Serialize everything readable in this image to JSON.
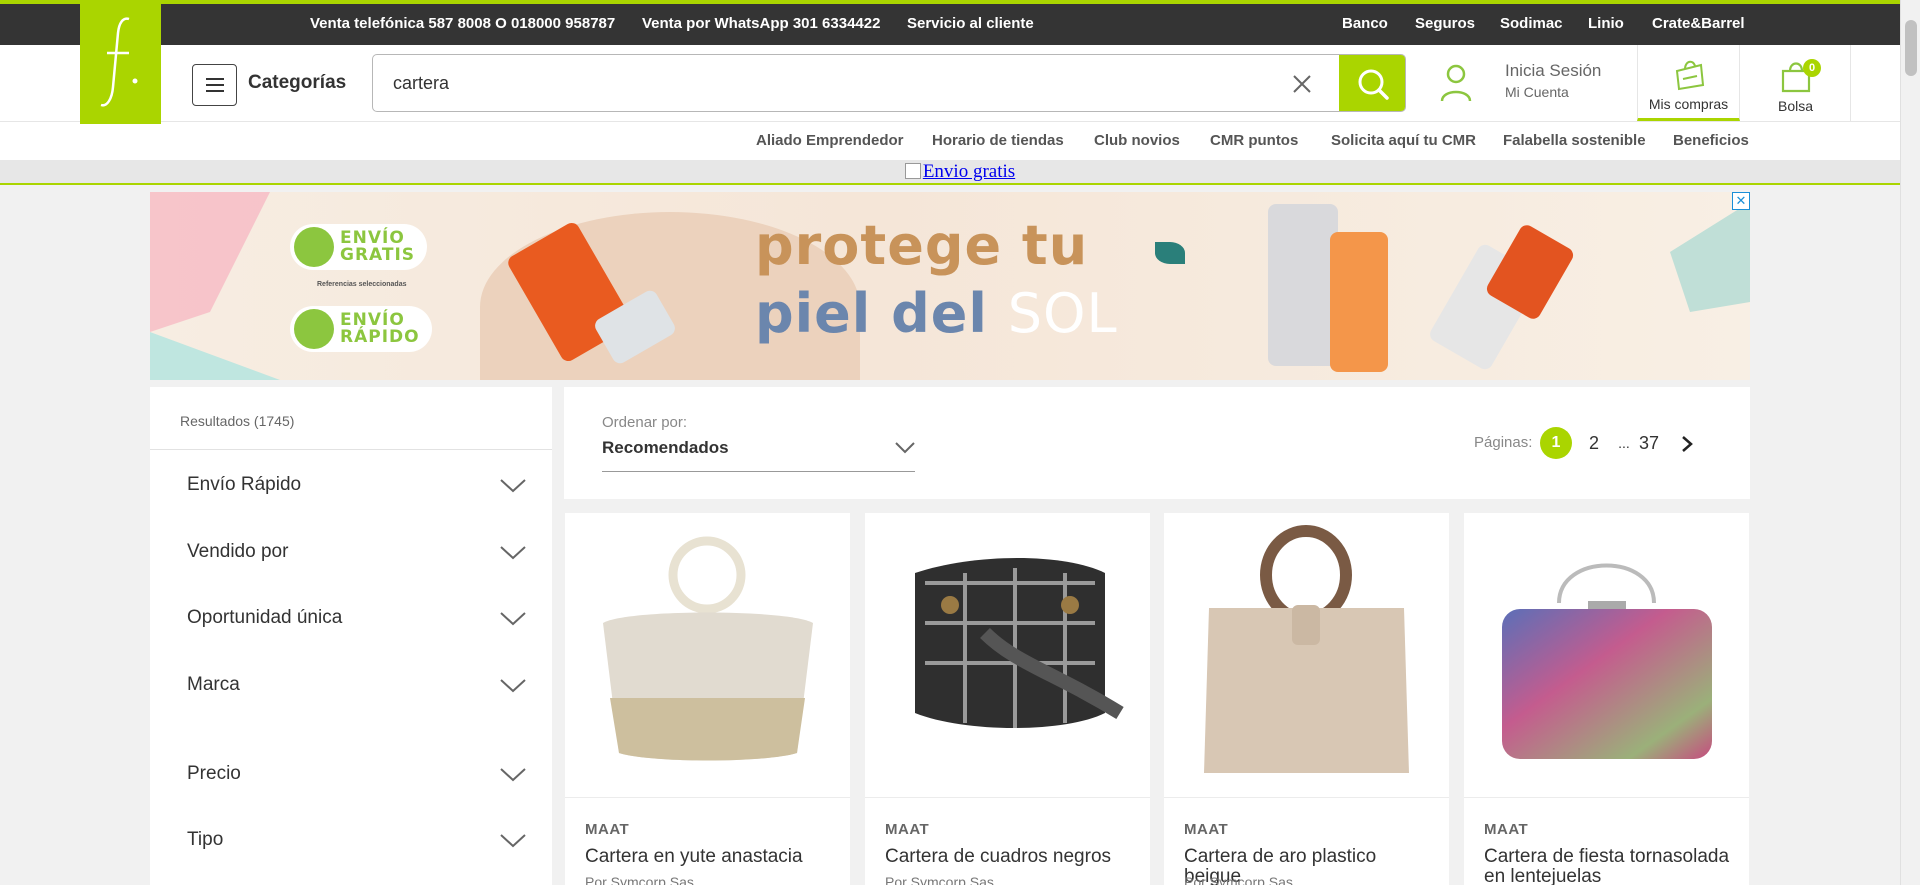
{
  "topbar": {
    "phone": "Venta telefónica 587 8008 O 018000 958787",
    "whatsapp": "Venta por WhatsApp 301 6334422",
    "service": "Servicio al cliente",
    "links": [
      "Banco",
      "Seguros",
      "Sodimac",
      "Linio",
      "Crate&Barrel"
    ]
  },
  "header": {
    "categories_label": "Categorías",
    "search_value": "cartera",
    "login_title": "Inicia Sesión",
    "login_sub": "Mi Cuenta",
    "purchases_label": "Mis compras",
    "bag_label": "Bolsa",
    "bag_count": "0"
  },
  "sublinks": [
    "Aliado Emprendedor",
    "Horario de tiendas",
    "Club novios",
    "CMR puntos",
    "Solicita aquí tu CMR",
    "Falabella sostenible",
    "Beneficios"
  ],
  "promo_strip": {
    "alt_text": "Envio gratis"
  },
  "banner": {
    "badge1_line1": "ENVÍO",
    "badge1_line2": "GRATIS",
    "badge1_sub": "Referencias seleccionadas",
    "badge2_line1": "ENVÍO",
    "badge2_line2": "RÁPIDO",
    "headline1": "protege tu",
    "headline2": "piel del",
    "headline2_accent": "SOL",
    "close": "✕"
  },
  "sidebar": {
    "results": "Resultados (1745)",
    "facets": [
      "Envío Rápido",
      "Vendido por",
      "Oportunidad única",
      "Marca",
      "Precio",
      "Tipo"
    ]
  },
  "sort": {
    "label": "Ordenar por:",
    "value": "Recomendados",
    "pages_label": "Páginas:",
    "pages": [
      "1",
      "2",
      "...",
      "37"
    ],
    "current_page": "1"
  },
  "products": [
    {
      "brand": "MAAT",
      "title": "Cartera en yute anastacia",
      "seller": "Por Symcorp Sas"
    },
    {
      "brand": "MAAT",
      "title": "Cartera de cuadros negros",
      "seller": "Por Symcorp Sas"
    },
    {
      "brand": "MAAT",
      "title": "Cartera de aro plastico beigue",
      "seller": "Por Symcorp Sas"
    },
    {
      "brand": "MAAT",
      "title": "Cartera de fiesta tornasolada en lentejuelas",
      "seller": ""
    }
  ],
  "colors": {
    "accent": "#aad500",
    "topbar": "#343434"
  }
}
